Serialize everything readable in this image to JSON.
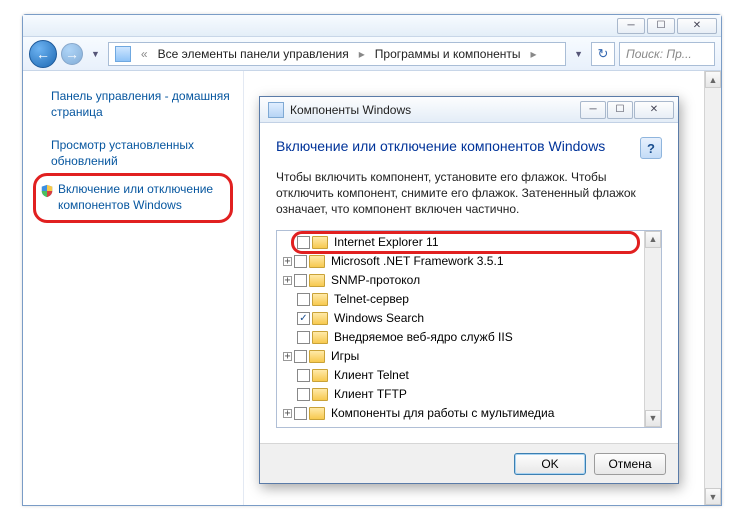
{
  "parent": {
    "breadcrumb1": "Все элементы панели управления",
    "breadcrumb2": "Программы и компоненты",
    "search_placeholder": "Поиск: Пр..."
  },
  "sidebar": {
    "items": [
      {
        "label": "Панель управления - домашняя страница"
      },
      {
        "label": "Просмотр установленных обновлений"
      },
      {
        "label": "Включение или отключение компонентов Windows"
      }
    ]
  },
  "dialog": {
    "title": "Компоненты Windows",
    "heading": "Включение или отключение компонентов Windows",
    "body": "Чтобы включить компонент, установите его флажок. Чтобы отключить компонент, снимите его флажок. Затененный флажок означает, что компонент включен частично.",
    "ok": "OK",
    "cancel": "Отмена"
  },
  "tree": {
    "items": [
      {
        "label": "Internet Explorer 11",
        "checked": false,
        "expandable": false,
        "highlight": true
      },
      {
        "label": "Microsoft .NET Framework 3.5.1",
        "checked": false,
        "expandable": true
      },
      {
        "label": "SNMP-протокол",
        "checked": false,
        "expandable": true
      },
      {
        "label": "Telnet-сервер",
        "checked": false,
        "expandable": false
      },
      {
        "label": "Windows Search",
        "checked": true,
        "expandable": false
      },
      {
        "label": "Внедряемое веб-ядро служб IIS",
        "checked": false,
        "expandable": false
      },
      {
        "label": "Игры",
        "checked": false,
        "expandable": true
      },
      {
        "label": "Клиент Telnet",
        "checked": false,
        "expandable": false
      },
      {
        "label": "Клиент TFTP",
        "checked": false,
        "expandable": false
      },
      {
        "label": "Компоненты для работы с мультимедиа",
        "checked": false,
        "expandable": true
      }
    ]
  }
}
